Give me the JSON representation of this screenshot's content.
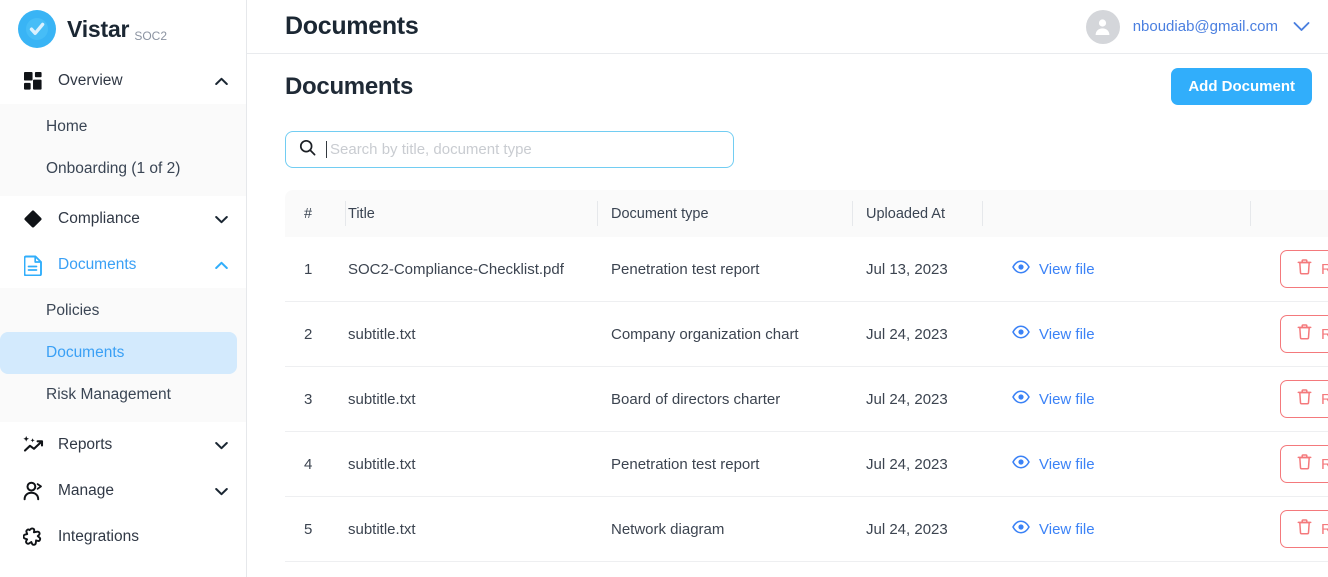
{
  "brand": {
    "name": "Vistar",
    "suffix": "SOC2",
    "logo_icon": "check-circle-icon",
    "logo_color": "#39b4f5"
  },
  "sidebar": {
    "groups": [
      {
        "label": "Overview",
        "icon": "grid-icon",
        "chevron": "chevron-up-icon",
        "expanded": true,
        "active": false,
        "items": [
          {
            "label": "Home",
            "selected": false
          },
          {
            "label": "Onboarding (1 of 2)",
            "selected": false
          }
        ]
      },
      {
        "label": "Compliance",
        "icon": "diamond-icon",
        "chevron": "chevron-down-icon",
        "expanded": false,
        "active": false,
        "items": []
      },
      {
        "label": "Documents",
        "icon": "document-icon",
        "chevron": "chevron-up-icon",
        "expanded": true,
        "active": true,
        "items": [
          {
            "label": "Policies",
            "selected": false
          },
          {
            "label": "Documents",
            "selected": true
          },
          {
            "label": "Risk Management",
            "selected": false
          }
        ]
      },
      {
        "label": "Reports",
        "icon": "sparkle-chart-icon",
        "chevron": "chevron-down-icon",
        "expanded": false,
        "active": false,
        "items": []
      },
      {
        "label": "Manage",
        "icon": "person-icon",
        "chevron": "chevron-down-icon",
        "expanded": false,
        "active": false,
        "items": []
      },
      {
        "label": "Integrations",
        "icon": "puzzle-icon",
        "chevron": "",
        "expanded": false,
        "active": false,
        "items": []
      }
    ]
  },
  "topbar": {
    "title": "Documents",
    "avatar_icon": "user-avatar-icon",
    "email": "nboudiab@gmail.com",
    "chevron": "chevron-down-icon"
  },
  "page": {
    "title": "Documents",
    "add_button_label": "Add Document"
  },
  "search": {
    "icon": "search-icon",
    "placeholder": "Search by title, document type",
    "value": ""
  },
  "table": {
    "columns": [
      "#",
      "Title",
      "Document type",
      "Uploaded At",
      "",
      ""
    ],
    "row_action_view_label": "View file",
    "row_action_view_icon": "eye-icon",
    "row_action_remove_label": "Remove",
    "row_action_remove_icon": "trash-icon",
    "rows": [
      {
        "num": "1",
        "title": "SOC2-Compliance-Checklist.pdf",
        "type": "Penetration test report",
        "uploaded": "Jul 13, 2023"
      },
      {
        "num": "2",
        "title": "subtitle.txt",
        "type": "Company organization chart",
        "uploaded": "Jul 24, 2023"
      },
      {
        "num": "3",
        "title": "subtitle.txt",
        "type": "Board of directors charter",
        "uploaded": "Jul 24, 2023"
      },
      {
        "num": "4",
        "title": "subtitle.txt",
        "type": "Penetration test report",
        "uploaded": "Jul 24, 2023"
      },
      {
        "num": "5",
        "title": "subtitle.txt",
        "type": "Network diagram",
        "uploaded": "Jul 24, 2023"
      }
    ]
  },
  "colors": {
    "accent_blue": "#31aefb",
    "link_blue": "#3b82f6",
    "danger_red": "#f4797c",
    "selected_bg": "#d3eafd",
    "subnav_bg": "#fafafa"
  }
}
